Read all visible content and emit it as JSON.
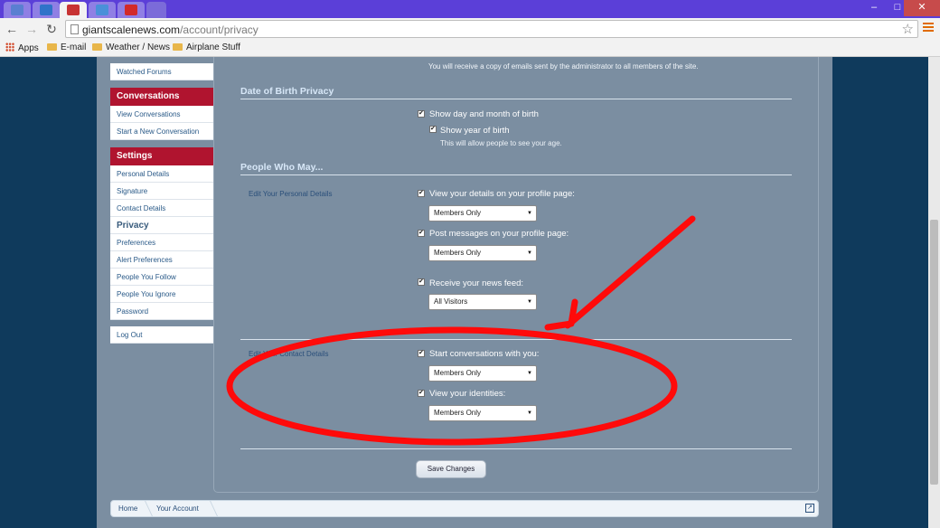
{
  "browser": {
    "url_domain": "giantscalenews.com",
    "url_path": "/account/privacy",
    "bookmarks": [
      "Apps",
      "E-mail",
      "Weather / News",
      "Airplane Stuff"
    ],
    "colors": {
      "titlebar": "#5b3fd8",
      "accent": "#b0142f"
    }
  },
  "sidebar": {
    "watched_forums": "Watched Forums",
    "conversations_head": "Conversations",
    "view_conversations": "View Conversations",
    "start_conversation": "Start a New Conversation",
    "settings_head": "Settings",
    "settings_items": [
      "Personal Details",
      "Signature",
      "Contact Details",
      "Privacy",
      "Preferences",
      "Alert Preferences",
      "People You Follow",
      "People You Ignore",
      "Password"
    ],
    "current_item": "Privacy",
    "logout": "Log Out"
  },
  "form": {
    "top_note": "You will receive a copy of emails sent by the administrator to all members of the site.",
    "dob_title": "Date of Birth Privacy",
    "show_dob": "Show day and month of birth",
    "show_year": "Show year of birth",
    "show_year_hint": "This will allow people to see your age.",
    "people_title": "People Who May...",
    "personal_label": "Edit Your Personal Details",
    "view_details": "View your details on your profile page:",
    "view_details_value": "Members Only",
    "post_messages": "Post messages on your profile page:",
    "post_messages_value": "Members Only",
    "news_feed": "Receive your news feed:",
    "news_feed_value": "All Visitors",
    "contact_label": "Edit Your Contact Details",
    "start_conversations": "Start conversations with you:",
    "start_conversations_value": "Members Only",
    "view_identities": "View your identities:",
    "view_identities_value": "Members Only",
    "save_label": "Save Changes"
  },
  "breadcrumb": [
    "Home",
    "Your Account"
  ]
}
